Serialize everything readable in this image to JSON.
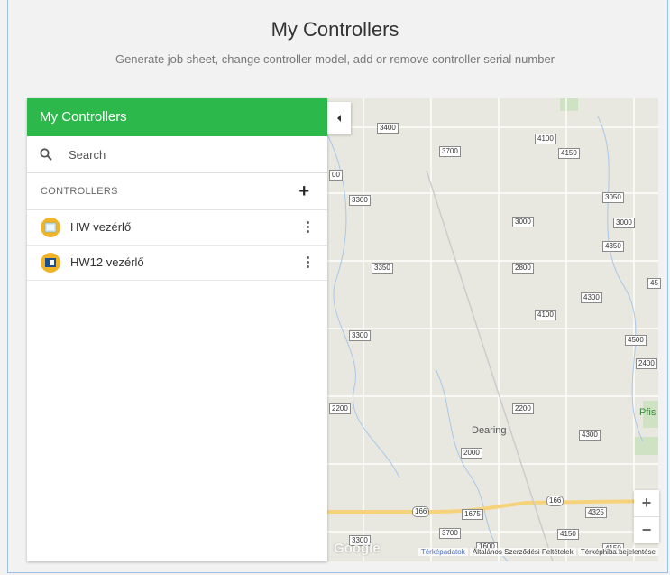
{
  "header": {
    "title": "My Controllers",
    "subtitle": "Generate job sheet, change controller model, add or remove controller serial number"
  },
  "panel": {
    "title": "My Controllers",
    "search_placeholder": "Search",
    "section_label": "CONTROLLERS",
    "items": [
      {
        "label": "HW vezérlő",
        "icon": "hw-controller-icon"
      },
      {
        "label": "HW12 vezérlő",
        "icon": "hw12-controller-icon"
      }
    ]
  },
  "map": {
    "road_labels": [
      "3400",
      "3700",
      "4100",
      "4150",
      "3050",
      "3000",
      "3000",
      "4350",
      "3300",
      "3350",
      "2800",
      "4300",
      "4100",
      "4500",
      "2400",
      "3300",
      "2200",
      "2200",
      "4300",
      "2000",
      "1675",
      "4325",
      "166",
      "166",
      "3700",
      "4150",
      "1600",
      "4150",
      "3300",
      "45",
      "00"
    ],
    "towns": [
      "Dearing",
      "Pfis"
    ],
    "attribution": {
      "data": "Térképadatok",
      "terms": "Általános Szerződési Feltételek",
      "report": "Térképhiba bejelentése"
    },
    "logo": "Google"
  },
  "colors": {
    "accent": "#2db84b",
    "avatar": "#f0b429"
  }
}
